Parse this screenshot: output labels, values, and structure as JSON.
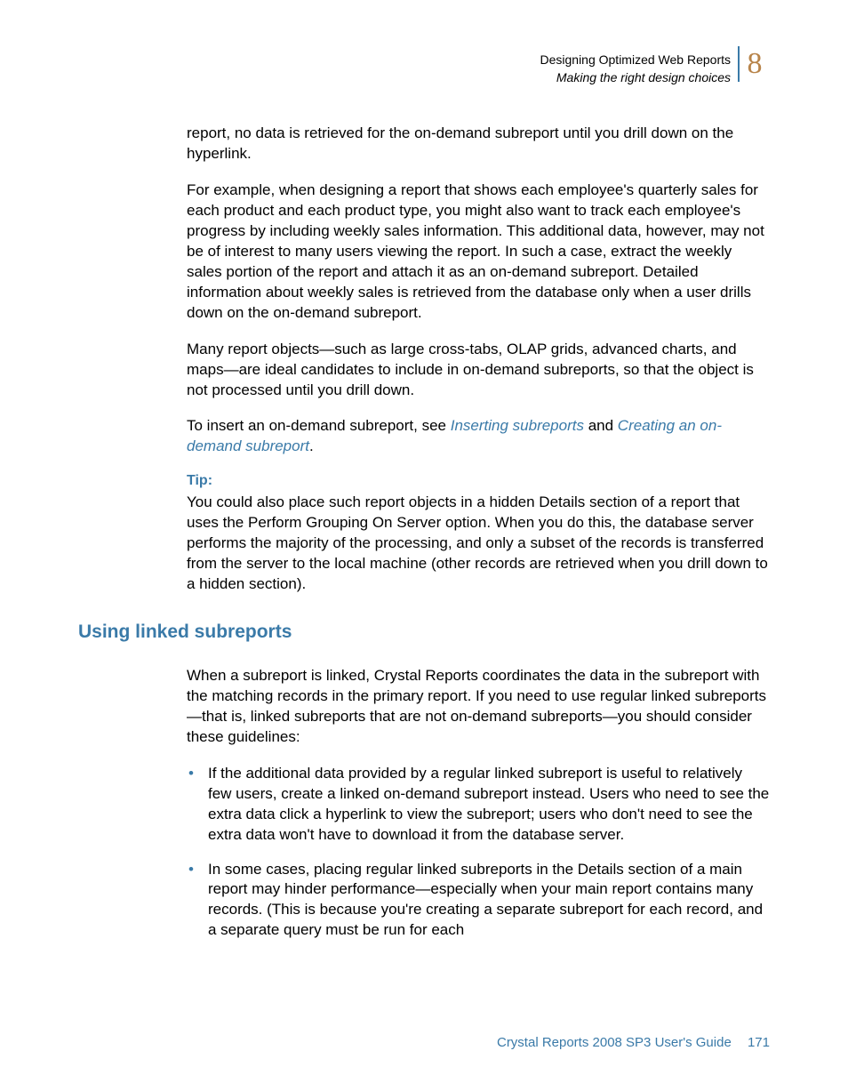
{
  "header": {
    "title": "Designing Optimized Web Reports",
    "subtitle": "Making the right design choices",
    "chapter": "8"
  },
  "body": {
    "p1": "report, no data is retrieved for the on-demand subreport until you drill down on the hyperlink.",
    "p2": "For example, when designing a report that shows each employee's quarterly sales for each product and each product type, you might also want to track each employee's progress by including weekly sales information. This additional data, however, may not be of interest to many users viewing the report. In such a case, extract the weekly sales portion of the report and attach it as an on-demand subreport. Detailed information about weekly sales is retrieved from the database only when a user drills down on the on-demand subreport.",
    "p3": "Many report objects—such as large cross-tabs, OLAP grids, advanced charts, and maps—are ideal candidates to include in on-demand subreports, so that the object is not processed until you drill down.",
    "p4_pre": "To insert an on-demand subreport, see ",
    "p4_link1": "Inserting subreports",
    "p4_mid": " and ",
    "p4_link2": "Creating an on-demand subreport",
    "p4_post": ".",
    "tip_label": "Tip:",
    "tip_body": "You could also place such report objects in a hidden Details section of a report that uses the Perform Grouping On Server option. When you do this, the database server performs the majority of the processing, and only a subset of the records is transferred from the server to the local machine (other records are retrieved when you drill down to a hidden section)."
  },
  "section": {
    "heading": "Using linked subreports",
    "intro": "When a subreport is linked, Crystal Reports coordinates the data in the subreport with the matching records in the primary report. If you need to use regular linked subreports—that is, linked subreports that are not on-demand subreports—you should consider these guidelines:",
    "bullets": [
      "If the additional data provided by a regular linked subreport is useful to relatively few users, create a linked on-demand subreport instead. Users who need to see the extra data click a hyperlink to view the subreport; users who don't need to see the extra data won't have to download it from the database server.",
      "In some cases, placing regular linked subreports in the Details section of a main report may hinder performance—especially when your main report contains many records. (This is because you're creating a separate subreport for each record, and a separate query must be run for each"
    ]
  },
  "footer": {
    "doc": "Crystal Reports 2008 SP3 User's Guide",
    "page": "171"
  }
}
